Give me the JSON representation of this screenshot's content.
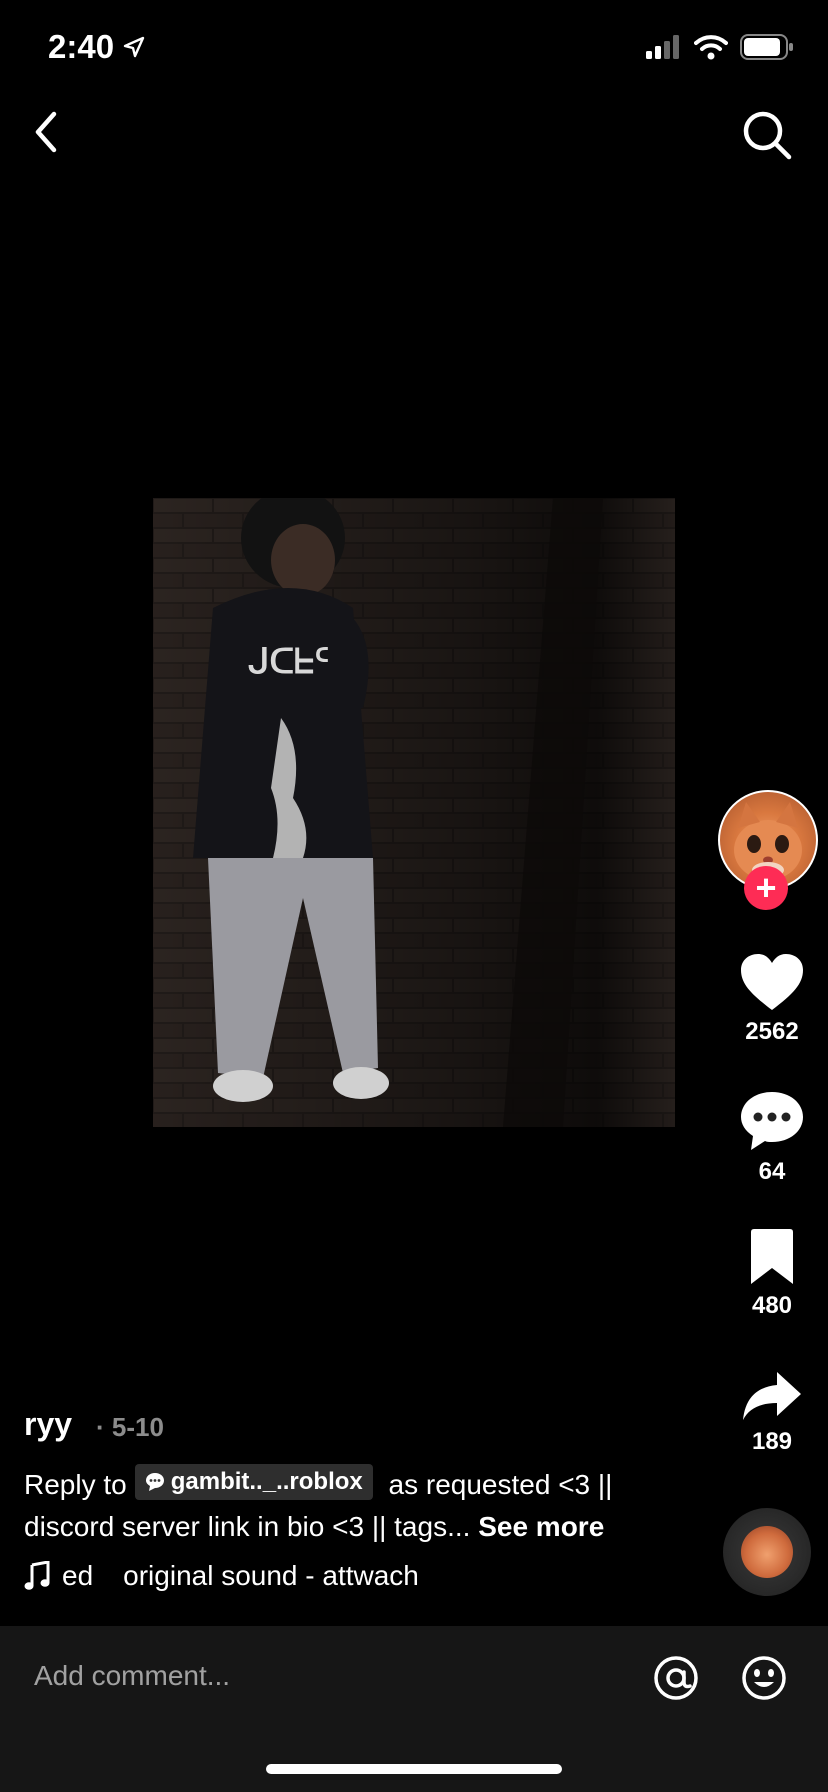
{
  "status_bar": {
    "time": "2:40"
  },
  "nav": {
    "back_icon": "chevron-left-icon",
    "search_icon": "search-icon"
  },
  "video": {
    "author_avatar_icon": "cat-avatar"
  },
  "actions": {
    "likes": "2562",
    "comments": "64",
    "saves": "480",
    "shares": "189"
  },
  "post": {
    "username": "ryy",
    "date": "· 5-10",
    "reply_prefix": "Reply to",
    "reply_user": "gambit.._..roblox",
    "caption_line1": "as requested <3 ||",
    "caption_line2": "discord server link in bio <3 || tags...",
    "see_more": "See more"
  },
  "sound": {
    "text_left": "ed",
    "text_main": "original sound - attwach"
  },
  "comment_bar": {
    "placeholder": "Add comment..."
  },
  "colors": {
    "accent": "#fe2c55",
    "background": "#000000",
    "comment_bar": "#161616"
  }
}
